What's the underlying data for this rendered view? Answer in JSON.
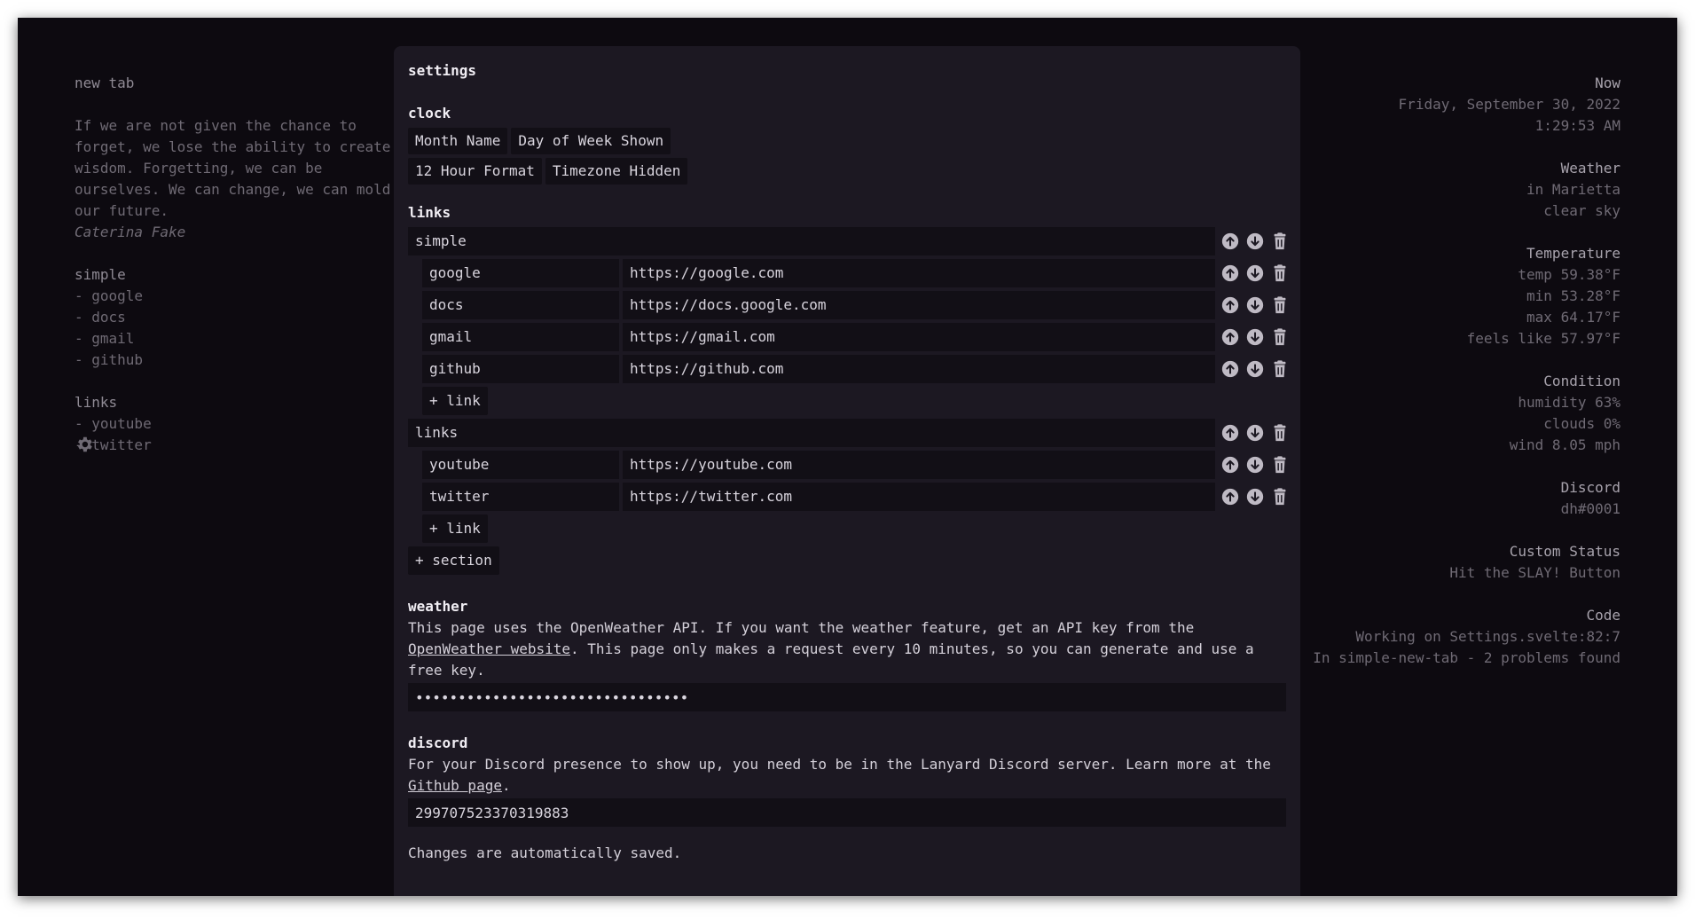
{
  "page": {
    "title": "new tab",
    "quote": "If we are not given the chance to forget, we lose the ability to create wisdom. Forgetting, we can be ourselves. We can change, we can mold our future.",
    "quote_author": "Caterina Fake"
  },
  "left_sections": [
    {
      "title": "simple",
      "items": [
        "- google",
        "- docs",
        "- gmail",
        "- github"
      ]
    },
    {
      "title": "links",
      "items": [
        "- youtube",
        "- twitter"
      ]
    }
  ],
  "right_panel": [
    {
      "heading": "Now",
      "lines": [
        "Friday, September 30, 2022",
        "1:29:53 AM"
      ]
    },
    {
      "heading": "Weather",
      "lines": [
        "in Marietta",
        "clear sky"
      ]
    },
    {
      "heading": "Temperature",
      "lines": [
        "temp 59.38°F",
        "min 53.28°F",
        "max 64.17°F",
        "feels like 57.97°F"
      ]
    },
    {
      "heading": "Condition",
      "lines": [
        "humidity 63%",
        "clouds 0%",
        "wind 8.05 mph"
      ]
    },
    {
      "heading": "Discord",
      "lines": [
        "dh#0001"
      ]
    },
    {
      "heading": "Custom Status",
      "lines": [
        "Hit the SLAY! Button"
      ]
    },
    {
      "heading": "Code",
      "lines": [
        "Working on Settings.svelte:82:7",
        "In simple-new-tab - 2 problems found"
      ]
    }
  ],
  "settings": {
    "title": "settings",
    "clock": {
      "heading": "clock",
      "options_row1": [
        "Month Name",
        "Day of Week Shown"
      ],
      "options_row2": [
        "12 Hour Format",
        "Timezone Hidden"
      ]
    },
    "links": {
      "heading": "links",
      "sections": [
        {
          "name": "simple",
          "links": [
            {
              "label": "google",
              "url": "https://google.com"
            },
            {
              "label": "docs",
              "url": "https://docs.google.com"
            },
            {
              "label": "gmail",
              "url": "https://gmail.com"
            },
            {
              "label": "github",
              "url": "https://github.com"
            }
          ],
          "add_label": "+ link"
        },
        {
          "name": "links",
          "links": [
            {
              "label": "youtube",
              "url": "https://youtube.com"
            },
            {
              "label": "twitter",
              "url": "https://twitter.com"
            }
          ],
          "add_label": "+ link"
        }
      ],
      "add_section_label": "+ section"
    },
    "weather": {
      "heading": "weather",
      "text_before": "This page uses the OpenWeather API. If you want the weather feature, get an API key from the ",
      "link_text": "OpenWeather website",
      "text_after": ". This page only makes a request every 10 minutes, so you can generate and use a free key.",
      "api_key_value": "••••••••••••••••••••••••••••••••"
    },
    "discord": {
      "heading": "discord",
      "text_before": "For your Discord presence to show up, you need to be in the Lanyard Discord server. Learn more at the ",
      "link_text": "Github page",
      "text_after": ".",
      "user_id_value": "299707523370319883"
    },
    "footer": "Changes are automatically saved."
  },
  "icons": {
    "move_up": "arrow-up-circle-icon",
    "move_down": "arrow-down-circle-icon",
    "delete": "trash-icon",
    "settings": "gear-icon"
  },
  "colors": {
    "background": "#0d0a10",
    "modal": "#1c1822",
    "field": "#120f16",
    "text": "#e6e2ea",
    "dim_text": "#6f6a74",
    "icon": "#bfbac4"
  }
}
